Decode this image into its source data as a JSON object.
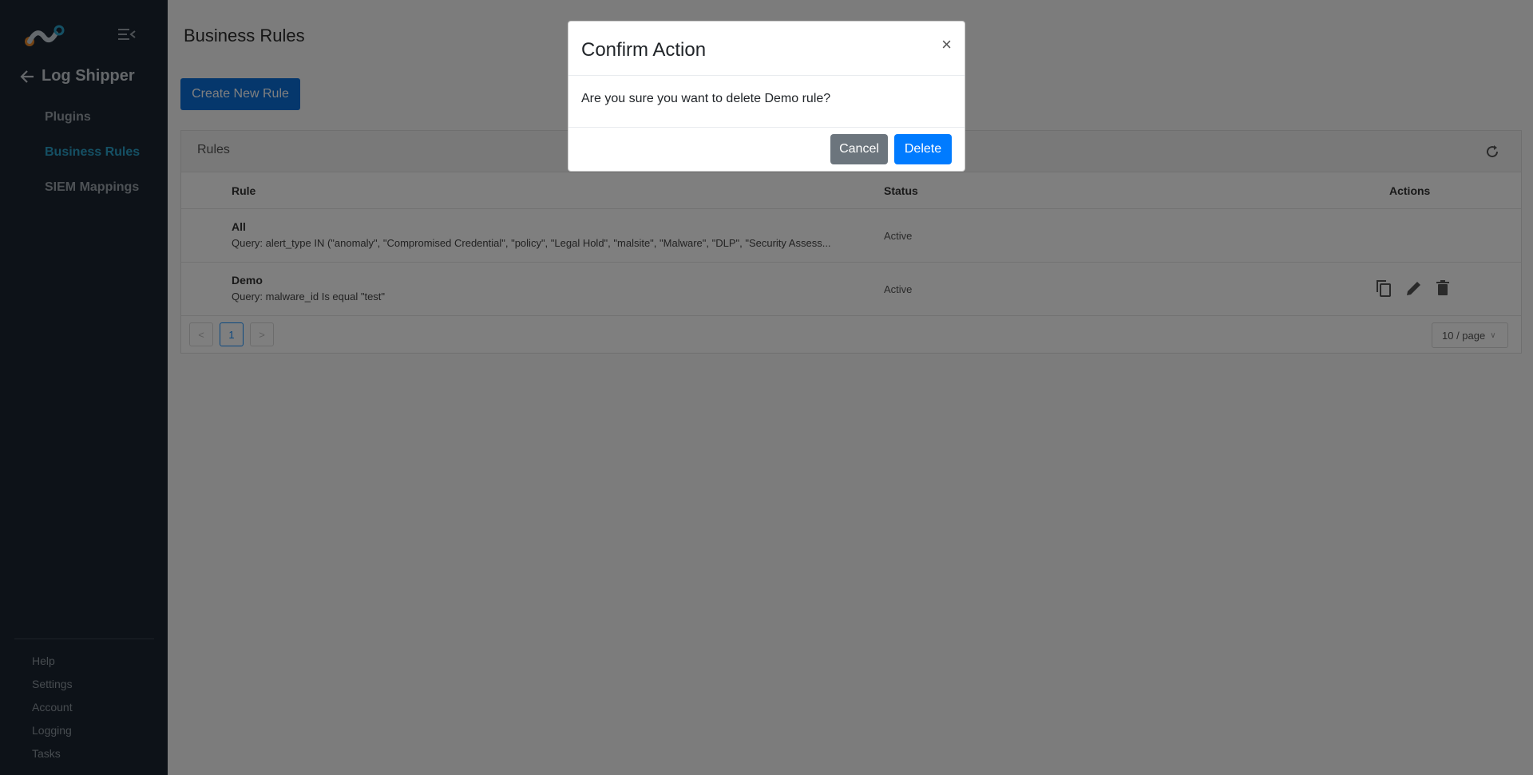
{
  "sidebar": {
    "back_title": "Log Shipper",
    "items": [
      {
        "label": "Plugins",
        "active": false
      },
      {
        "label": "Business Rules",
        "active": true
      },
      {
        "label": "SIEM Mappings",
        "active": false
      }
    ],
    "bottom_items": [
      {
        "label": "Help"
      },
      {
        "label": "Settings"
      },
      {
        "label": "Account"
      },
      {
        "label": "Logging"
      },
      {
        "label": "Tasks"
      }
    ]
  },
  "main": {
    "page_title": "Business Rules",
    "create_button_label": "Create New Rule",
    "card_title": "Rules",
    "columns": {
      "rule": "Rule",
      "status": "Status",
      "actions": "Actions"
    },
    "rows": [
      {
        "name": "All",
        "query": "Query: alert_type IN (\"anomaly\", \"Compromised Credential\", \"policy\", \"Legal Hold\", \"malsite\", \"Malware\", \"DLP\", \"Security Assess...",
        "status": "Active"
      },
      {
        "name": "Demo",
        "query": "Query: malware_id Is equal \"test\"",
        "status": "Active"
      }
    ],
    "pagination": {
      "prev": "<",
      "current_page": "1",
      "next": ">",
      "page_size": "10 / page"
    }
  },
  "modal": {
    "title": "Confirm Action",
    "close": "×",
    "body": "Are you sure you want to delete Demo rule?",
    "cancel_label": "Cancel",
    "delete_label": "Delete"
  },
  "colors": {
    "sidebar_bg": "#1b2530",
    "active_nav": "#2aa1c8",
    "primary": "#0a6fd9",
    "delete_button": "#007bff",
    "cancel_button": "#6c757d"
  }
}
